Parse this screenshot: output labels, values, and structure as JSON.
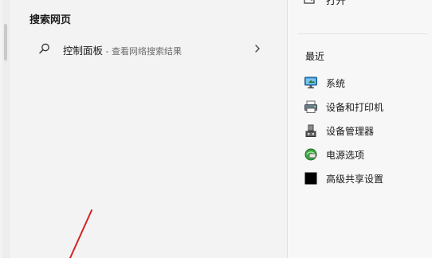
{
  "left": {
    "section_title": "搜索网页",
    "result": {
      "title": "控制面板",
      "separator": " - ",
      "subtitle": "查看网络搜索结果",
      "icon": "search-icon",
      "chevron": "chevron-right-icon"
    }
  },
  "right": {
    "open_label": "打开",
    "recent_title": "最近",
    "recent_items": [
      {
        "label": "系统",
        "icon": "system-monitor-icon"
      },
      {
        "label": "设备和打印机",
        "icon": "printer-icon"
      },
      {
        "label": "设备管理器",
        "icon": "device-manager-icon"
      },
      {
        "label": "电源选项",
        "icon": "power-options-icon"
      },
      {
        "label": "高级共享设置",
        "icon": "sharing-settings-icon"
      }
    ]
  },
  "annotation_color": "#d22222"
}
